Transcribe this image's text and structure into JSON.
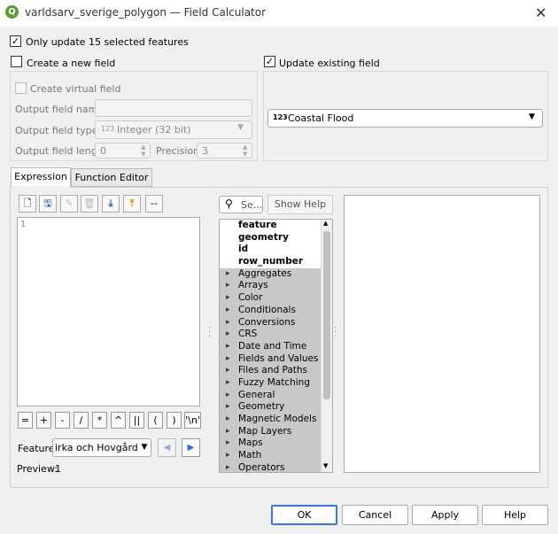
{
  "window": {
    "title": "varldsarv_sverige_polygon — Field Calculator",
    "close_glyph": "✕"
  },
  "only_update": {
    "checked": true,
    "label": "Only update 15 selected features"
  },
  "create_new": {
    "checked": false,
    "label": "Create a new field",
    "virtual_label": "Create virtual field",
    "name_label": "Output field name",
    "name_value": "",
    "type_label": "Output field type",
    "type_prefix": "123",
    "type_value": "Integer (32 bit)",
    "length_label": "Output field length",
    "length_value": "0",
    "precision_label": "Precision",
    "precision_value": "3"
  },
  "update_existing": {
    "checked": true,
    "label": "Update existing field",
    "field_prefix": "123",
    "field_value": "Coastal Flood"
  },
  "tabs": [
    {
      "label": "Expression"
    },
    {
      "label": "Function Editor"
    }
  ],
  "toolbar": {
    "more_label": "--"
  },
  "editor": {
    "line_number": "1"
  },
  "operators": [
    "=",
    "+",
    "-",
    "/",
    "*",
    "^",
    "||",
    "(",
    ")",
    "'\\n'"
  ],
  "feature": {
    "label": "Feature",
    "value": "irka och Hovgården"
  },
  "preview": {
    "label": "Preview:",
    "value": "1"
  },
  "search": {
    "placeholder": "Se..."
  },
  "show_help": {
    "label": "Show Help"
  },
  "function_list": {
    "bold_items": [
      "feature",
      "geometry",
      "id",
      "row_number"
    ],
    "groups": [
      "Aggregates",
      "Arrays",
      "Color",
      "Conditionals",
      "Conversions",
      "CRS",
      "Date and Time",
      "Fields and Values",
      "Files and Paths",
      "Fuzzy Matching",
      "General",
      "Geometry",
      "Magnetic Models",
      "Map Layers",
      "Maps",
      "Math",
      "Operators"
    ]
  },
  "buttons": {
    "ok": "OK",
    "cancel": "Cancel",
    "apply": "Apply",
    "help": "Help"
  },
  "colors": {
    "accent": "#3c78d8",
    "group_bg": "#c8c8c8",
    "logo_green": "#5a9b2f"
  }
}
